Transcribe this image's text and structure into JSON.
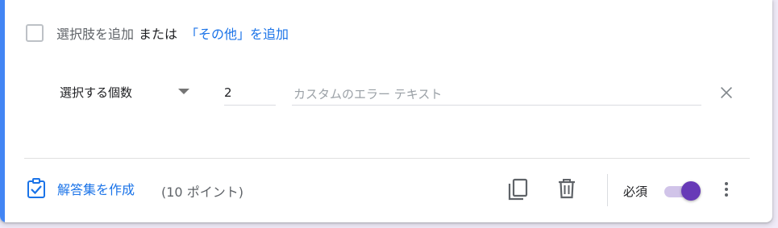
{
  "options": {
    "add_option_label": "選択肢を追加",
    "or_label": "または",
    "add_other_label": "「その他」を追加"
  },
  "validation": {
    "rule_select_value": "選択する個数",
    "number_value": "2",
    "error_placeholder": "カスタムのエラー テキスト"
  },
  "footer": {
    "answer_key_label": "解答集を作成",
    "points_label": "(10 ポイント)",
    "required_label": "必須",
    "required_on": true
  },
  "icons": {
    "checkbox": "checkbox-outline-icon",
    "clear": "close-icon",
    "answer_key": "assignment-check-icon",
    "duplicate": "copy-icon",
    "delete": "trash-icon",
    "more": "more-vert-icon"
  },
  "colors": {
    "accent": "#4285f4",
    "link": "#1a73e8",
    "toggle_on": "#673ab7"
  }
}
